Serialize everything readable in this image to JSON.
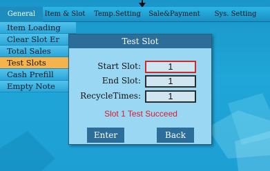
{
  "tabs": [
    {
      "label": "General"
    },
    {
      "label": "Item & Slot"
    },
    {
      "label": "Temp.Setting"
    },
    {
      "label": "Sale&Payment"
    },
    {
      "label": "Sys. Setting"
    }
  ],
  "sidebar": {
    "items": [
      {
        "label": "Item Loading"
      },
      {
        "label": "Clear Slot Er"
      },
      {
        "label": "Total Sales"
      },
      {
        "label": "Test Slots"
      },
      {
        "label": "Cash Prefill"
      },
      {
        "label": "Empty Note"
      }
    ]
  },
  "dialog": {
    "title": "Test Slot",
    "fields": [
      {
        "label": "Start Slot:",
        "value": "1"
      },
      {
        "label": "End Slot:",
        "value": "1"
      },
      {
        "label": "RecycleTimes:",
        "value": "1"
      }
    ],
    "status": "Slot 1 Test Succeed",
    "enter_label": "Enter",
    "back_label": "Back"
  },
  "colors": {
    "background": "#1d9fd4",
    "dialog_bg": "#99d7f3",
    "dialog_header": "#2c6d9a",
    "selected_item": "#f6b24b",
    "status_text": "#e0182c",
    "focused_border": "#d02828"
  }
}
